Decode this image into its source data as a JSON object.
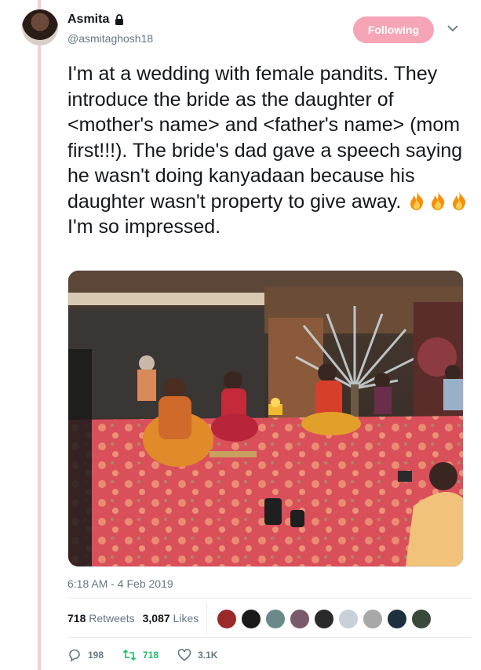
{
  "author": {
    "name": "Asmita",
    "handle": "@asmitaghosh18",
    "protected_icon": "lock-icon"
  },
  "follow_button": {
    "label": "Following",
    "color": "#f6a5b6"
  },
  "menu_icon": "chevron-down-icon",
  "tweet": {
    "text_before_emoji": "I'm at a wedding with female pandits. They introduce the bride as the daughter of <mother's name> and <father's name> (mom first!!!). The bride's dad gave a speech saying he wasn't doing kanyadaan because his daughter wasn't property to give away.",
    "emoji": [
      "fire-icon",
      "fire-icon",
      "fire-icon"
    ],
    "text_after_emoji": "I'm so impressed."
  },
  "timestamp": "6:18 AM - 4 Feb 2019",
  "stats": {
    "retweets_count": "718",
    "retweets_label": "Retweets",
    "likes_count": "3,087",
    "likes_label": "Likes"
  },
  "actions": {
    "replies": "198",
    "retweets": "718",
    "likes": "3.1K"
  },
  "colors": {
    "thread_line": "#f3cfd5",
    "retweet_green": "#17bf63",
    "secondary_text": "#657786"
  }
}
